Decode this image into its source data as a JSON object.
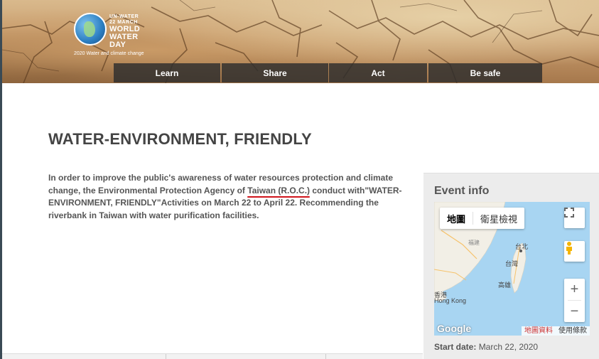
{
  "logo": {
    "line1": "UN-WATER",
    "line2": "22 MARCH",
    "line3": "WORLD",
    "line4": "WATER",
    "line5": "DAY",
    "caption": "2020 Water and climate change"
  },
  "nav": {
    "items": [
      {
        "label": "Learn"
      },
      {
        "label": "Share"
      },
      {
        "label": "Act"
      },
      {
        "label": "Be safe"
      }
    ]
  },
  "page": {
    "title": "WATER-ENVIRONMENT, FRIENDLY",
    "intro_before": "In order to improve the public's awareness of water resources protection and climate change, the Environmental Protection Agency of ",
    "intro_highlight": "Taiwan (R.O.C.)",
    "intro_after": " conduct with\"WATER-ENVIRONMENT, FRIENDLY\"Activities on March 22 to April 22. Recommending the riverbank in Taiwan with water purification facilities."
  },
  "event": {
    "title": "Event info",
    "start_label": "Start date:",
    "start_value": "March 22, 2020"
  },
  "map": {
    "type_map": "地圖",
    "type_satellite": "衛星檢視",
    "labels": {
      "fujian": "福建",
      "taipei": "台北",
      "taiwan": "台灣",
      "kaohsiung": "高雄",
      "hongkong_zh": "香港",
      "hongkong_en": "Hong Kong"
    },
    "google": "Google",
    "map_data": "地圖資料",
    "terms": "使用條款",
    "zoom_in": "+",
    "zoom_out": "−",
    "fullscreen_icon": "fullscreen-icon",
    "pegman_icon": "pegman-icon",
    "colors": {
      "water": "#a8d5f2",
      "land": "#f2efe6"
    }
  }
}
